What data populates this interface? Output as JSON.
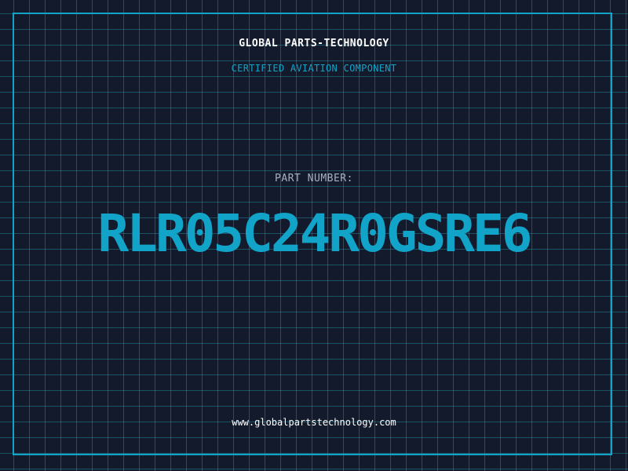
{
  "brand": {
    "name": "GLOBAL PARTS-TECHNOLOGY",
    "tagline": "CERTIFIED AVIATION COMPONENT"
  },
  "part": {
    "label": "PART NUMBER:",
    "number": "RLR05C24R0GSRE6"
  },
  "footer": {
    "website": "www.globalpartstechnology.com"
  },
  "colors": {
    "background": "#131a2c",
    "accent": "#12a4c8",
    "grid": "#1f6a7a",
    "text_primary": "#ffffff",
    "text_muted": "#a7b1c2"
  }
}
